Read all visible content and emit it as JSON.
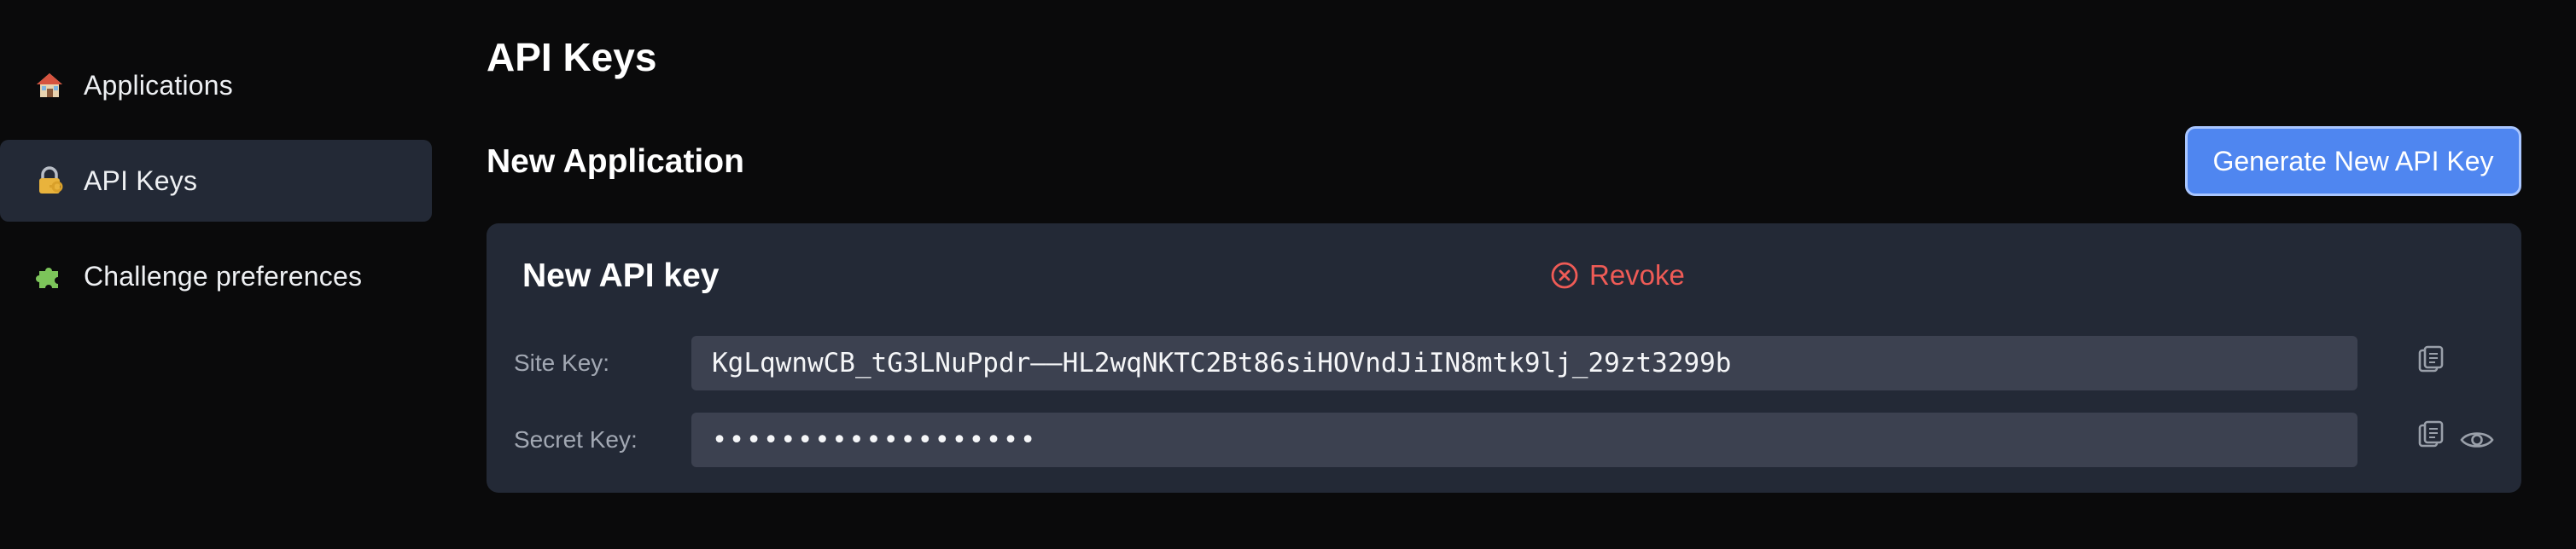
{
  "sidebar": {
    "items": [
      {
        "label": "Applications",
        "icon": "house-icon",
        "active": false
      },
      {
        "label": "API Keys",
        "icon": "lock-key-icon",
        "active": true
      },
      {
        "label": "Challenge preferences",
        "icon": "puzzle-icon",
        "active": false
      }
    ]
  },
  "page": {
    "title": "API Keys",
    "section_title": "New Application",
    "generate_button_label": "Generate New API Key"
  },
  "card": {
    "title": "New API key",
    "revoke_label": "Revoke",
    "site_key": {
      "label": "Site Key:",
      "value": "KgLqwnwCB_tG3LNuPpdr––HL2wqNKTC2Bt86siHOVndJiIN8mtk9lj_29zt3299b"
    },
    "secret_key": {
      "label": "Secret Key:",
      "value": "•••••••••••••••••••"
    }
  },
  "colors": {
    "background": "#0a0a0b",
    "card": "#232936",
    "field": "#3c4150",
    "accent": "#4f86f0",
    "danger": "#ef5b56"
  }
}
